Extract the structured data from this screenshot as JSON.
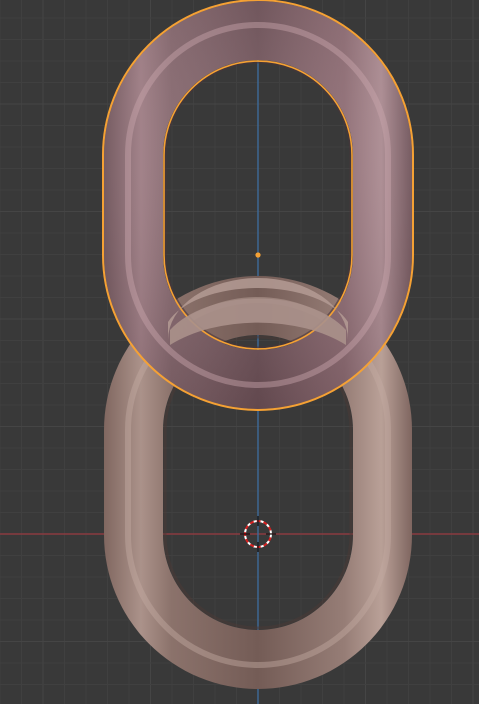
{
  "viewport": {
    "name": "3D Viewport",
    "background_color": "#393939",
    "grid_minor_color": "#404040",
    "grid_major_color": "#454545",
    "x_axis_color": "#8a3a40",
    "y_axis_color": "#3d6a9a"
  },
  "objects": [
    {
      "name": "chain-link-top",
      "selected": true,
      "color": "#a07e86",
      "outline_color": "#f5a134"
    },
    {
      "name": "chain-link-bottom",
      "selected": false,
      "color": "#a08a84"
    }
  ],
  "icons": {
    "origin": "object-origin-dot",
    "cursor": "3d-cursor"
  }
}
